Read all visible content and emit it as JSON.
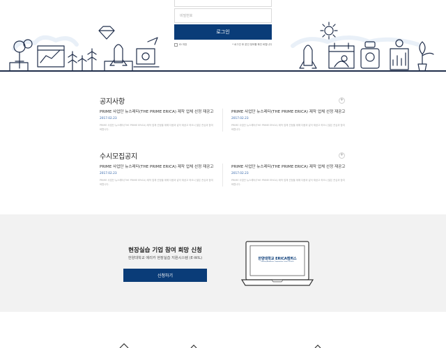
{
  "login": {
    "password_placeholder": "비밀번호",
    "login_button": "로그인",
    "remember_label": "ID 저장",
    "help_text": "* 로그인 후 본인 정보를 확인 바랍니다"
  },
  "notices": {
    "title": "공지사항",
    "more_label": "+",
    "posts": [
      {
        "title": "PRIME 사업단 뉴스레터(THE PRIME ERICA) 제작 업체 선정 재공고",
        "date": "2017.02.23",
        "desc": "PRIME 사업단 뉴스레터(THE PRIME ERICA) 제작 업체 선정을 위해 다음과 같이 재공고 하오니 많은 관심과 참여 바랍니다."
      },
      {
        "title": "PRIME 사업단 뉴스레터(THE PRIME ERICA) 제작 업체 선정 재공고",
        "date": "2017.02.23",
        "desc": "PRIME 사업단 뉴스레터(THE PRIME ERICA) 제작 업체 선정을 위해 다음과 같이 재공고 하오니 많은 관심과 참여 바랍니다."
      }
    ]
  },
  "recruit": {
    "title": "수시모집공지",
    "more_label": "+",
    "posts": [
      {
        "title": "PRIME 사업단 뉴스레터(THE PRIME ERICA) 제작 업체 선정 재공고",
        "date": "2017.02.23",
        "desc": "PRIME 사업단 뉴스레터(THE PRIME ERICA) 제작 업체 선정을 위해 다음과 같이 재공고 하오니 많은 관심과 참여 바랍니다."
      },
      {
        "title": "PRIME 사업단 뉴스레터(THE PRIME ERICA) 제작 업체 선정 재공고",
        "date": "2017.02.23",
        "desc": "PRIME 사업단 뉴스레터(THE PRIME ERICA) 제작 업체 선정을 위해 다음과 같이 재공고 하오니 많은 관심과 참여 바랍니다."
      }
    ]
  },
  "apply": {
    "title": "현장실습 기업 참여 희망 신청",
    "subtitle": "한양대학교 에리카 현장실습 지원시스템 (E-WIL)",
    "button": "신청하기",
    "laptop_logo_main": "한양대학교 ERICA캠퍼스",
    "laptop_logo_sub": "Industry-Academic Cooperation Center of Erica"
  },
  "colors": {
    "brand": "#0a3c78",
    "date": "#2f62a8",
    "line_art": "#1f2d4a",
    "apply_bg": "#f2f2f2"
  }
}
